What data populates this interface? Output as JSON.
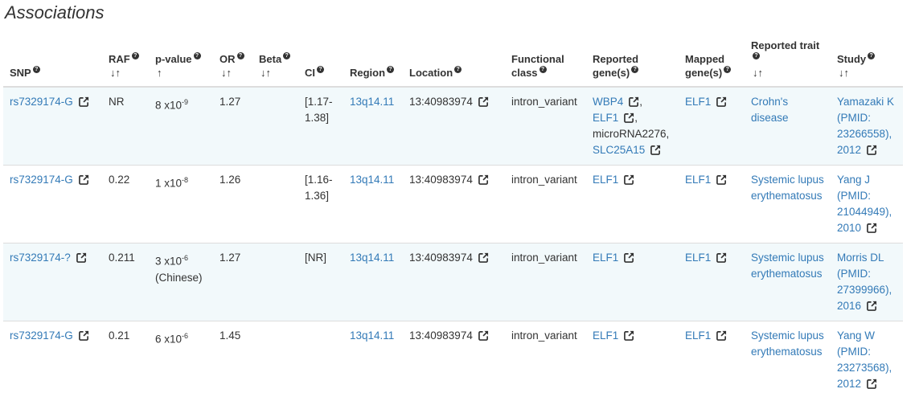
{
  "page_title": "Associations",
  "columns": [
    {
      "key": "snp",
      "label": "SNP",
      "help": true,
      "sort": ""
    },
    {
      "key": "raf",
      "label": "RAF",
      "help": true,
      "sort": "↓↑"
    },
    {
      "key": "pvalue",
      "label": "p-value",
      "help": true,
      "sort": "↑"
    },
    {
      "key": "or",
      "label": "OR",
      "help": true,
      "sort": "↓↑"
    },
    {
      "key": "beta",
      "label": "Beta",
      "help": true,
      "sort": "↓↑"
    },
    {
      "key": "ci",
      "label": "CI",
      "help": true,
      "sort": ""
    },
    {
      "key": "region",
      "label": "Region",
      "help": true,
      "sort": ""
    },
    {
      "key": "location",
      "label": "Location",
      "help": true,
      "sort": ""
    },
    {
      "key": "functional_class",
      "label": "Functional class",
      "help": true,
      "sort": ""
    },
    {
      "key": "reported_genes",
      "label": "Reported gene(s)",
      "help": true,
      "sort": ""
    },
    {
      "key": "mapped_genes",
      "label": "Mapped gene(s)",
      "help": true,
      "sort": ""
    },
    {
      "key": "reported_trait",
      "label": "Reported trait",
      "help": true,
      "sort": "↓↑"
    },
    {
      "key": "study",
      "label": "Study",
      "help": true,
      "sort": "↓↑"
    }
  ],
  "rows": [
    {
      "snp": "rs7329174-G",
      "raf": "NR",
      "pvalue_base": "8 x10",
      "pvalue_exp": "-9",
      "pvalue_note": "",
      "or": "1.27",
      "beta": "",
      "ci": "[1.17-1.38]",
      "region": "13q14.11",
      "location": "13:40983974",
      "functional_class": "intron_variant",
      "reported_genes": [
        {
          "name": "WBP4",
          "link": true,
          "sep": ","
        },
        {
          "name": "ELF1",
          "link": true,
          "sep": ","
        },
        {
          "name": "microRNA2276",
          "link": false,
          "sep": ","
        },
        {
          "name": "SLC25A15",
          "link": true,
          "sep": ""
        }
      ],
      "mapped_genes": "ELF1",
      "reported_trait": "Crohn's disease",
      "study": "Yamazaki K (PMID: 23266558), 2012"
    },
    {
      "snp": "rs7329174-G",
      "raf": "0.22",
      "pvalue_base": "1 x10",
      "pvalue_exp": "-8",
      "pvalue_note": "",
      "or": "1.26",
      "beta": "",
      "ci": "[1.16-1.36]",
      "region": "13q14.11",
      "location": "13:40983974",
      "functional_class": "intron_variant",
      "reported_genes": [
        {
          "name": "ELF1",
          "link": true,
          "sep": ""
        }
      ],
      "mapped_genes": "ELF1",
      "reported_trait": "Systemic lupus erythematosus",
      "study": "Yang J (PMID: 21044949), 2010"
    },
    {
      "snp": "rs7329174-?",
      "raf": "0.211",
      "pvalue_base": "3 x10",
      "pvalue_exp": "-6",
      "pvalue_note": "(Chinese)",
      "or": "1.27",
      "beta": "",
      "ci": "[NR]",
      "region": "13q14.11",
      "location": "13:40983974",
      "functional_class": "intron_variant",
      "reported_genes": [
        {
          "name": "ELF1",
          "link": true,
          "sep": ""
        }
      ],
      "mapped_genes": "ELF1",
      "reported_trait": "Systemic lupus erythematosus",
      "study": "Morris DL (PMID: 27399966), 2016"
    },
    {
      "snp": "rs7329174-G",
      "raf": "0.21",
      "pvalue_base": "6 x10",
      "pvalue_exp": "-6",
      "pvalue_note": "",
      "or": "1.45",
      "beta": "",
      "ci": "",
      "region": "13q14.11",
      "location": "13:40983974",
      "functional_class": "intron_variant",
      "reported_genes": [
        {
          "name": "ELF1",
          "link": true,
          "sep": ""
        }
      ],
      "mapped_genes": "ELF1",
      "reported_trait": "Systemic lupus erythematosus",
      "study": "Yang W (PMID: 23273568), 2012"
    }
  ],
  "colors": {
    "link": "#337ab7",
    "row_stripe": "#f2f9fb",
    "text": "#333333",
    "border": "#dddddd"
  },
  "icons": {
    "external": "external-link-icon",
    "help": "question-circle-icon",
    "sort": "sort-icon"
  }
}
